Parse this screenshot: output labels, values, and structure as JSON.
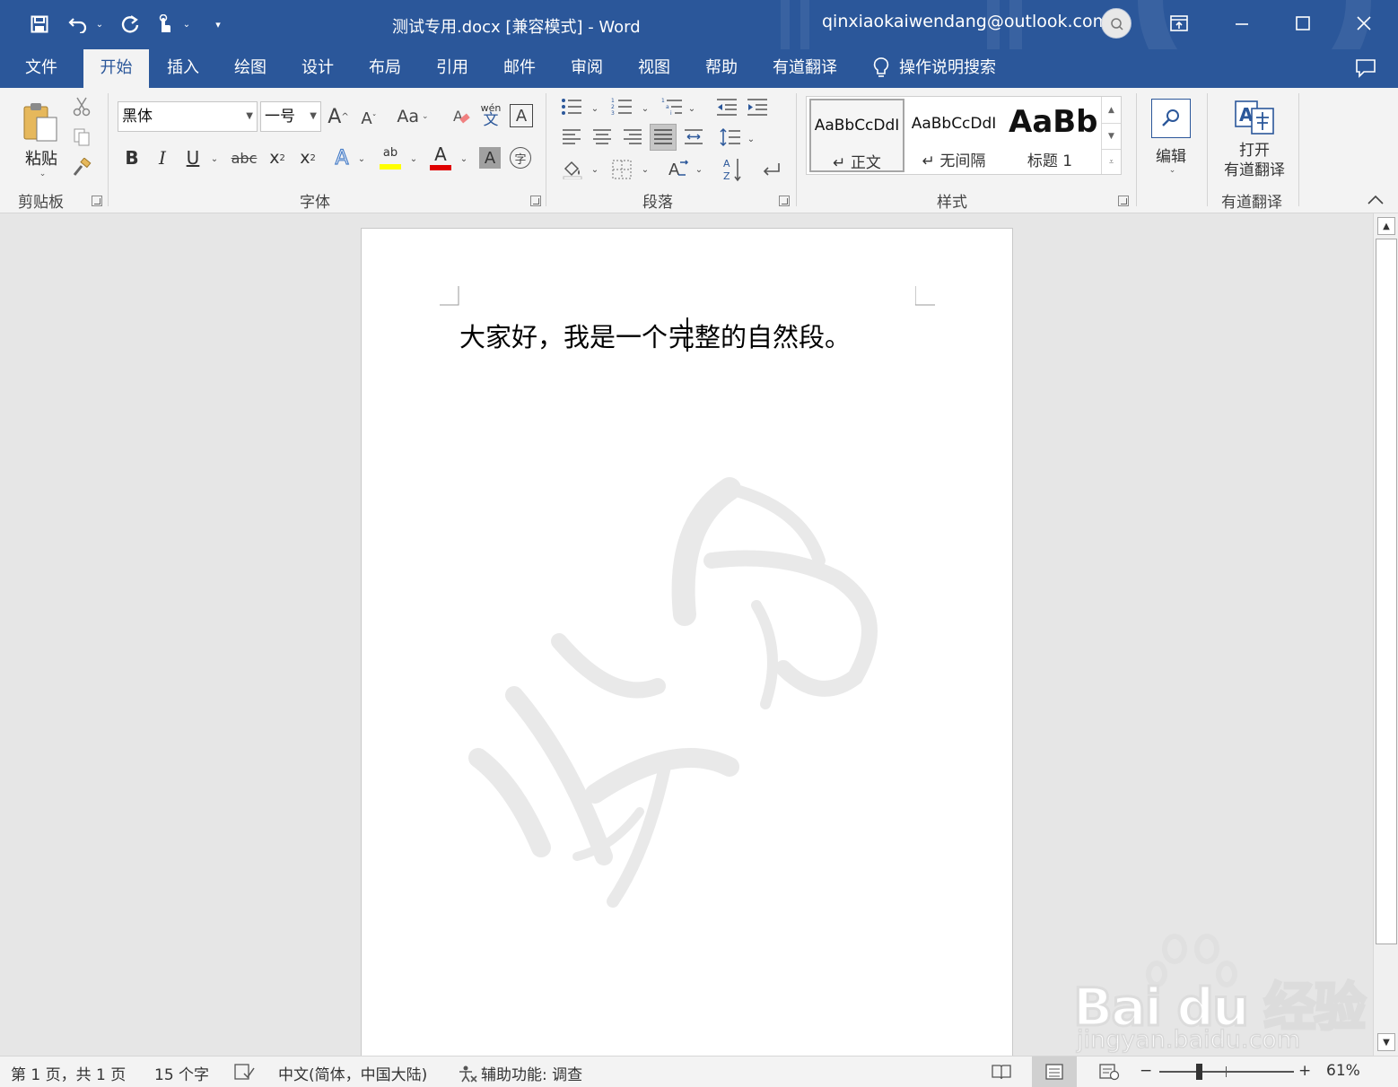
{
  "title_bar": {
    "document_title": "测试专用.docx [兼容模式]  -  Word",
    "account": "qinxiaokaiwendang@outlook.com",
    "qat_icons": [
      "save-icon",
      "undo-icon",
      "redo-icon",
      "touch-mode-icon",
      "customize-qat-icon"
    ],
    "window_controls": [
      "ribbon-display-options-icon",
      "minimize-icon",
      "maximize-icon",
      "close-icon"
    ]
  },
  "tabs": [
    {
      "label": "文件",
      "active": false
    },
    {
      "label": "开始",
      "active": true
    },
    {
      "label": "插入",
      "active": false
    },
    {
      "label": "绘图",
      "active": false
    },
    {
      "label": "设计",
      "active": false
    },
    {
      "label": "布局",
      "active": false
    },
    {
      "label": "引用",
      "active": false
    },
    {
      "label": "邮件",
      "active": false
    },
    {
      "label": "审阅",
      "active": false
    },
    {
      "label": "视图",
      "active": false
    },
    {
      "label": "帮助",
      "active": false
    },
    {
      "label": "有道翻译",
      "active": false
    }
  ],
  "tell_me": "操作说明搜索",
  "ribbon": {
    "clipboard": {
      "label": "剪贴板",
      "paste_label": "粘贴"
    },
    "font": {
      "label": "字体",
      "font_name": "黑体",
      "font_size": "一号",
      "change_case": "Aa",
      "phonetic_top": "wén",
      "phonetic_bottom": "文"
    },
    "paragraph": {
      "label": "段落"
    },
    "styles": {
      "label": "样式",
      "items": [
        {
          "preview": "AaBbCcDdI",
          "name": "↵ 正文",
          "selected": true
        },
        {
          "preview": "AaBbCcDdI",
          "name": "↵ 无间隔",
          "selected": false
        },
        {
          "preview": "AaBb",
          "name": "标题 1",
          "selected": false
        }
      ]
    },
    "editing": {
      "label": "编辑"
    },
    "youdao": {
      "label": "有道翻译",
      "button_line1": "打开",
      "button_line2": "有道翻译"
    }
  },
  "document": {
    "paragraph_before_caret": "大家好，我是一个",
    "paragraph_after_caret": "完整的自然段。"
  },
  "status_bar": {
    "page": "第 1 页，共 1 页",
    "word_count": "15 个字",
    "language": "中文(简体，中国大陆)",
    "accessibility": "辅助功能: 调查",
    "zoom_minus": "−",
    "zoom_plus": "+",
    "zoom": "61%"
  },
  "watermark": {
    "logo_text": "Bai du 经验",
    "url": "jingyan.baidu.com"
  },
  "colors": {
    "word_blue": "#2b579a",
    "highlight_yellow": "#ffff00",
    "font_color_red": "#e00000"
  }
}
